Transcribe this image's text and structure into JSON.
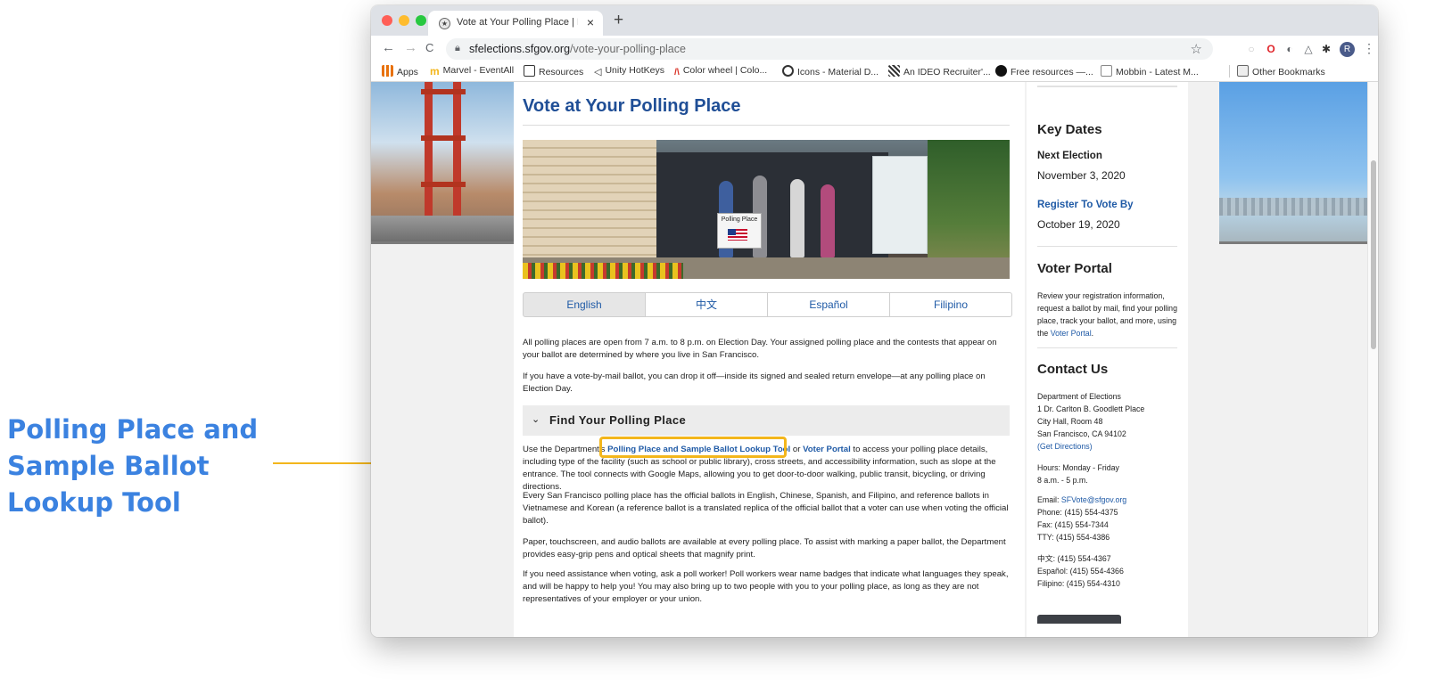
{
  "annotation": {
    "label": "Polling Place and Sample Ballot Lookup Tool",
    "highlight_color": "#f3b61c",
    "label_color": "#3b82e0"
  },
  "browser": {
    "tab": {
      "title": "Vote at Your Polling Place | Dep",
      "close": "×",
      "favicon": "seal-icon"
    },
    "new_tab": "+",
    "nav": {
      "back": "←",
      "forward": "→",
      "reload": "C"
    },
    "url_host": "sfelections.sfgov.org",
    "url_path": "/vote-your-polling-place",
    "bookmark_star": "☆",
    "extensions": [
      "○",
      "O",
      "◐",
      "△",
      "✱"
    ],
    "profile_initial": "R",
    "menu": "⋮"
  },
  "bookmarks": {
    "items": [
      {
        "label": "Apps",
        "icon": "apps-grid-icon",
        "color": "#e8710a"
      },
      {
        "label": "Marvel - EventAll",
        "icon": "marvel-icon",
        "color": "#f3b61c"
      },
      {
        "label": "Resources",
        "icon": "notion-icon",
        "color": "#333333"
      },
      {
        "label": "Unity HotKeys",
        "icon": "unity-icon",
        "color": "#333333"
      },
      {
        "label": "Color wheel | Colo...",
        "icon": "adobe-color-icon",
        "color": "#d93025"
      },
      {
        "label": "Icons - Material D...",
        "icon": "material-icon",
        "color": "#333333"
      },
      {
        "label": "An IDEO Recruiter'...",
        "icon": "ideo-icon",
        "color": "#333333"
      },
      {
        "label": "Free resources —...",
        "icon": "circle-icon",
        "color": "#111111"
      },
      {
        "label": "Mobbin - Latest M...",
        "icon": "mobbin-icon",
        "color": "#888888"
      }
    ],
    "other": "Other Bookmarks"
  },
  "page": {
    "title": "Vote at Your Polling Place",
    "hero_sign": "Polling Place",
    "languages": [
      "English",
      "中文",
      "Español",
      "Filipino"
    ],
    "intro": [
      "All polling places are open from 7 a.m. to 8 p.m. on Election Day. Your assigned polling place and the contests that appear on your ballot are determined by where you live in San Francisco.",
      "If you have a vote-by-mail ballot, you can drop it off—inside its signed and sealed return envelope—at any polling place on Election Day."
    ],
    "accordion_title": "Find Your Polling Place",
    "find": {
      "pre": "Use the Department's ",
      "tool_link": "Polling Place and Sample Ballot Lookup Tool",
      "mid": " or ",
      "portal_link": "Voter Portal",
      "post": " to access your polling place details, including type of the facility (such as school or public library), cross streets, and accessibility information, such as slope at the entrance. The tool connects with Google Maps, allowing you to get door-to-door walking, public transit, bicycling, or driving directions."
    },
    "body": [
      "Every San Francisco polling place has the official ballots in English, Chinese, Spanish, and Filipino, and reference ballots in Vietnamese and Korean (a reference ballot is a translated replica of the official ballot that a voter can use when voting the official ballot).",
      "Paper, touchscreen, and audio ballots are available at every polling place. To assist with marking a paper ballot, the Department provides easy-grip pens and optical sheets that magnify print.",
      "If you need assistance when voting, ask a poll worker! Poll workers wear name badges that indicate what languages they speak, and will be happy to help you! You may also bring up to two people with you to your polling place, as long as they are not representatives of your employer or your union."
    ]
  },
  "sidebar": {
    "key_dates_title": "Key Dates",
    "next_election_label": "Next Election",
    "next_election_date": "November 3, 2020",
    "register_label": "Register To Vote By",
    "register_date": "October 19, 2020",
    "portal_title": "Voter Portal",
    "portal_text_pre": "Review your registration information, request a ballot by mail, find your polling place, track your ballot, and more, using the ",
    "portal_link": "Voter Portal",
    "portal_text_post": ".",
    "contact_title": "Contact Us",
    "address": [
      "Department of Elections",
      "1 Dr. Carlton B. Goodlett Place",
      "City Hall, Room 48",
      "San Francisco, CA 94102"
    ],
    "directions_link": "(Get Directions)",
    "hours": [
      "Hours: Monday - Friday",
      "8 a.m. - 5 p.m."
    ],
    "email_label": "Email: ",
    "email": "SFVote@sfgov.org",
    "phones": [
      "Phone: (415) 554-4375",
      "Fax: (415) 554-7344",
      "TTY: (415) 554-4386"
    ],
    "lang_phones": [
      "中文: (415) 554-4367",
      "Español: (415) 554-4366",
      "Filipino: (415) 554-4310"
    ]
  }
}
